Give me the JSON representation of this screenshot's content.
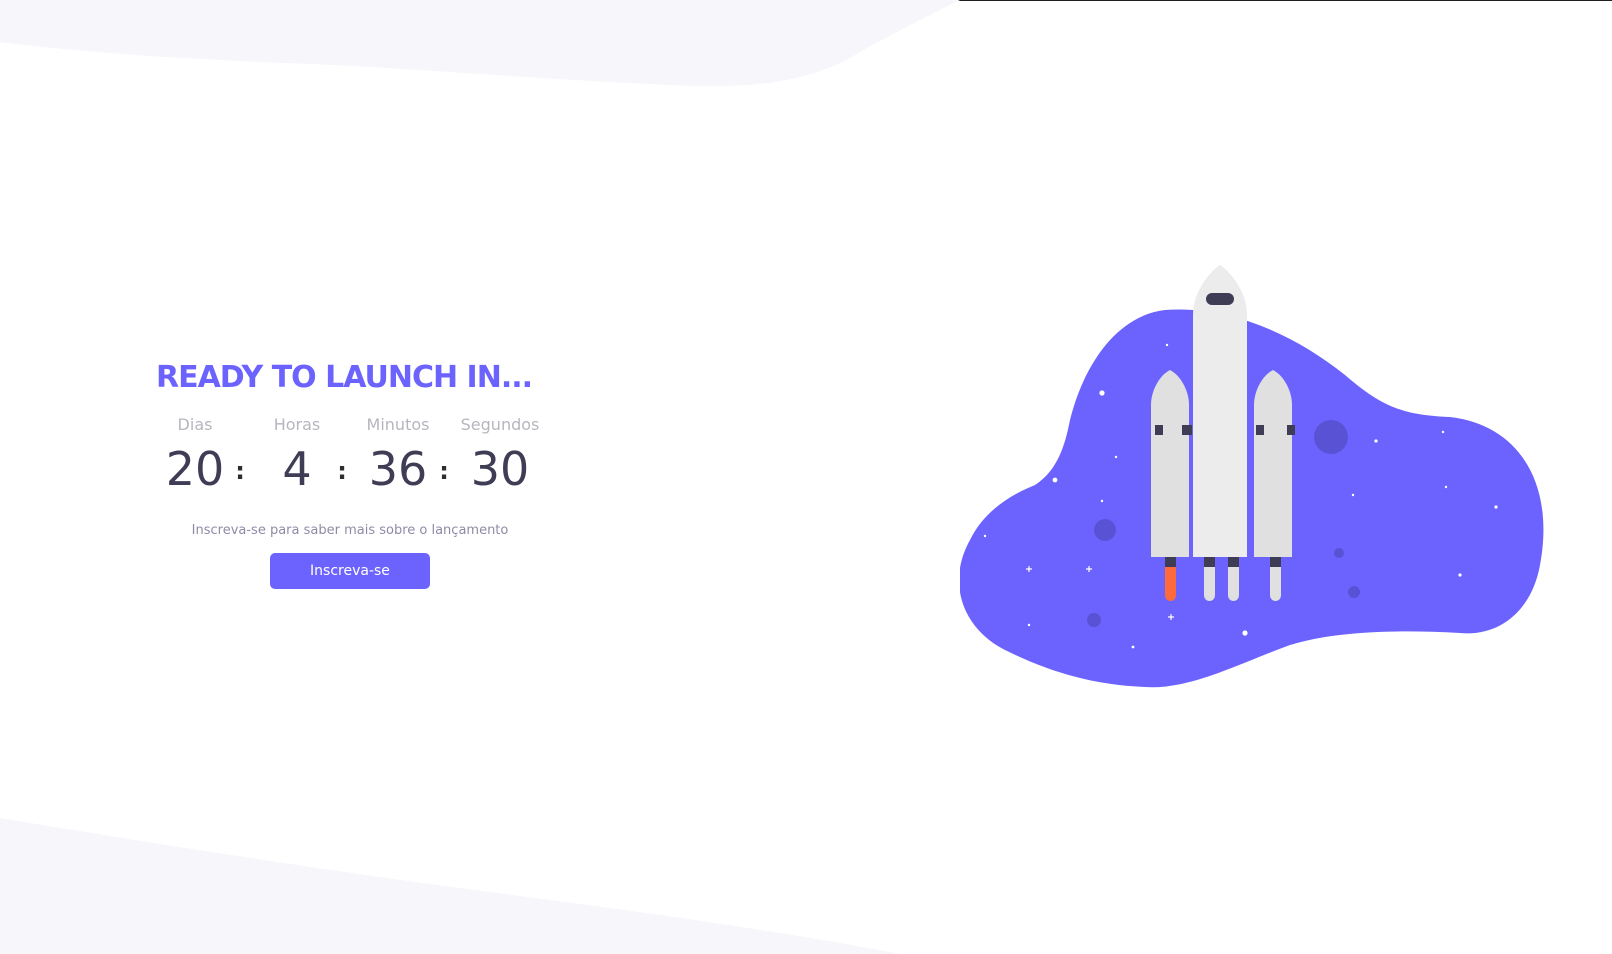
{
  "hero": {
    "headline": "READY TO LAUNCH IN...",
    "countdown": [
      {
        "label": "Dias",
        "value": "20"
      },
      {
        "label": "Horas",
        "value": "4"
      },
      {
        "label": "Minutos",
        "value": "36"
      },
      {
        "label": "Segundos",
        "value": "30"
      }
    ],
    "separator": ":",
    "subtitle": "Inscreva-se para saber mais sobre o lançamento",
    "cta_label": "Inscreva-se"
  },
  "colors": {
    "accent": "#6c63ff",
    "text_dark": "#3f3d56",
    "label_gray": "#b6b6bf",
    "blob_bg": "#f6f6fb"
  },
  "illustration": {
    "icon": "rocket-launch-illustration"
  }
}
